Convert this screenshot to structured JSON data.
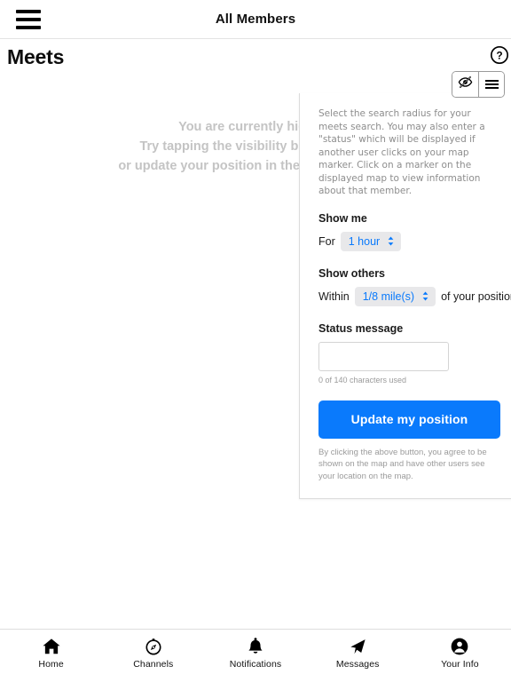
{
  "topbar": {
    "menu_icon": "hamburger-icon",
    "title": "All Members"
  },
  "page": {
    "title": "Meets",
    "help_icon": "question-circle-icon"
  },
  "toggle_group": {
    "visibility_icon": "eye-slash-icon",
    "options_icon": "hamburger-icon"
  },
  "hidden_message": {
    "line1": "You are currently hidden.",
    "line2": "Try tapping the visibility button above",
    "line3": "or update your position in the Options panel."
  },
  "options_panel": {
    "description": "Select the search radius for your meets search. You may also enter a \"status\" which will be displayed if another user clicks on your map marker. Click on a marker on the displayed map to view information about that member.",
    "show_me": {
      "heading": "Show me",
      "prefix": "For",
      "duration_value": "1 hour",
      "duration_options": [
        "1 hour"
      ]
    },
    "show_others": {
      "heading": "Show others",
      "prefix": "Within",
      "radius_value": "1/8 mile(s)",
      "radius_options": [
        "1/8 mile(s)"
      ],
      "suffix": "of your position"
    },
    "status": {
      "heading": "Status message",
      "value": "",
      "placeholder": "",
      "char_count": "0 of 140 characters used"
    },
    "submit_label": "Update my position",
    "disclaimer": "By clicking the above button, you agree to be shown on the map and have other users see your location on the map.",
    "accent_color": "#0a7afc"
  },
  "bottom_nav": [
    {
      "label": "Home",
      "icon": "home-icon"
    },
    {
      "label": "Channels",
      "icon": "compass-icon"
    },
    {
      "label": "Notifications",
      "icon": "bell-icon"
    },
    {
      "label": "Messages",
      "icon": "paper-plane-icon"
    },
    {
      "label": "Your Info",
      "icon": "user-circle-icon"
    }
  ]
}
